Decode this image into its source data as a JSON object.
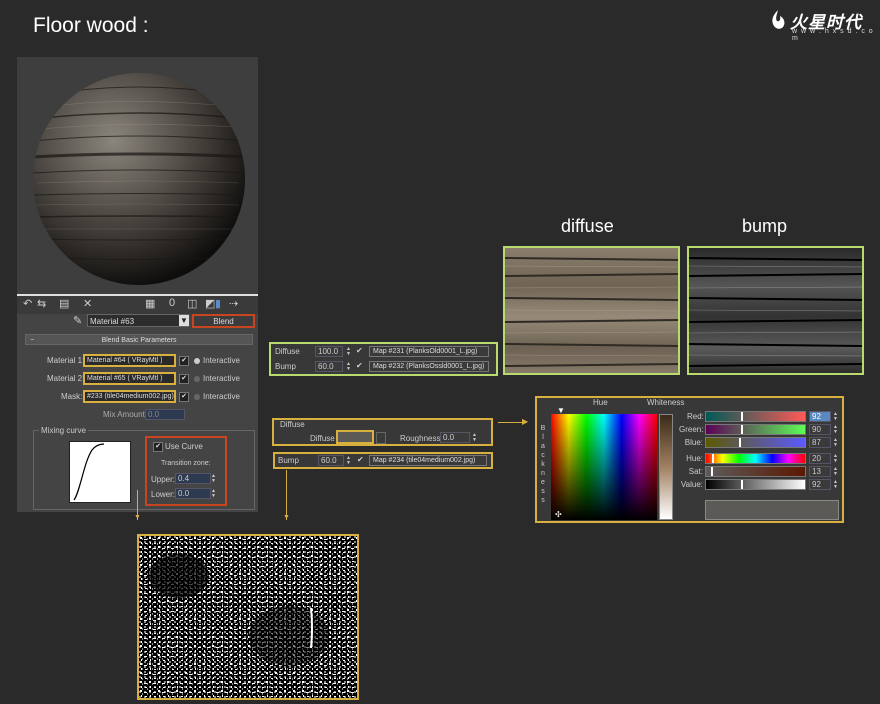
{
  "page": {
    "title": "Floor wood :"
  },
  "logo": {
    "main": "火星时代",
    "sub": "w w w . h x s d . c o m"
  },
  "editor": {
    "material_name": "Material #63",
    "type_button": "Blend",
    "rollout_title": "Blend Basic Parameters",
    "material1_label": "Material 1:",
    "material1_value": "Material #64  ( VRayMtl )",
    "material2_label": "Material 2:",
    "material2_value": "Material #65  ( VRayMtl )",
    "mask_label": "Mask:",
    "mask_value": "#233 (tile04medium002.jpg)",
    "interactive_label": "Interactive",
    "mix_amount_label": "Mix Amount:",
    "mix_amount_value": "0.0",
    "mixing_curve_label": "Mixing curve",
    "use_curve_label": "Use Curve",
    "transition_zone_label": "Transition zone:",
    "upper_label": "Upper:",
    "upper_value": "0.4",
    "lower_label": "Lower:",
    "lower_value": "0.0"
  },
  "textures": {
    "diffuse_label": "diffuse",
    "bump_label": "bump"
  },
  "maps_panel": {
    "diffuse_label": "Diffuse",
    "diffuse_amount": "100.0",
    "diffuse_map": "Map #231 (PlanksOld0001_L.jpg)",
    "bump_label": "Bump",
    "bump_amount": "60.0",
    "bump_map": "Map #232 (PlanksOssld0001_L.jpg)"
  },
  "diffuse_panel": {
    "group_label": "Diffuse",
    "diffuse_label": "Diffuse",
    "roughness_label": "Roughness",
    "roughness_value": "0.0"
  },
  "bump_panel": {
    "bump_label": "Bump",
    "bump_amount": "60.0",
    "bump_map": "Map #234 (tile04medium002.jpg)"
  },
  "color_picker": {
    "hue_label": "Hue",
    "whiteness_label": "Whiteness",
    "blackness_label": "B l a c k n e s s",
    "red_label": "Red:",
    "red_value": "92",
    "green_label": "Green:",
    "green_value": "90",
    "blue_label": "Blue:",
    "blue_value": "87",
    "hue2_label": "Hue:",
    "hue_value": "20",
    "sat_label": "Sat:",
    "sat_value": "13",
    "value_label": "Value:",
    "value_value": "92"
  },
  "colors": {
    "orange_highlight": "#c8461f",
    "yellow_highlight": "#d8b040",
    "green_highlight": "#b9da6f",
    "swatch": "#5c5a57"
  }
}
